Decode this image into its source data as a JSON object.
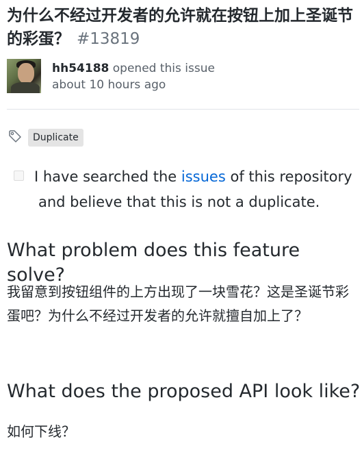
{
  "issue": {
    "title": "为什么不经过开发者的允许就在按钮上加上圣诞节的彩蛋？",
    "number": "#13819",
    "author": "hh54188",
    "opened_text": "opened this issue",
    "time": "about 10 hours ago"
  },
  "labels": [
    "Duplicate"
  ],
  "checkbox": {
    "checked": false,
    "text_before": "I have searched the ",
    "link_text": "issues",
    "text_after": " of this repository",
    "line2": "and believe that this is not a duplicate."
  },
  "sections": [
    {
      "heading": "What problem does this feature solve?",
      "body": "我留意到按钮组件的上方出现了一块雪花？这是圣诞节彩蛋吧？为什么不经过开发者的允许就擅自加上了？"
    },
    {
      "heading": "What does the proposed API look like?",
      "body": "如何下线？"
    }
  ],
  "icons": {
    "label": "tag-icon",
    "avatar": "user-avatar"
  }
}
